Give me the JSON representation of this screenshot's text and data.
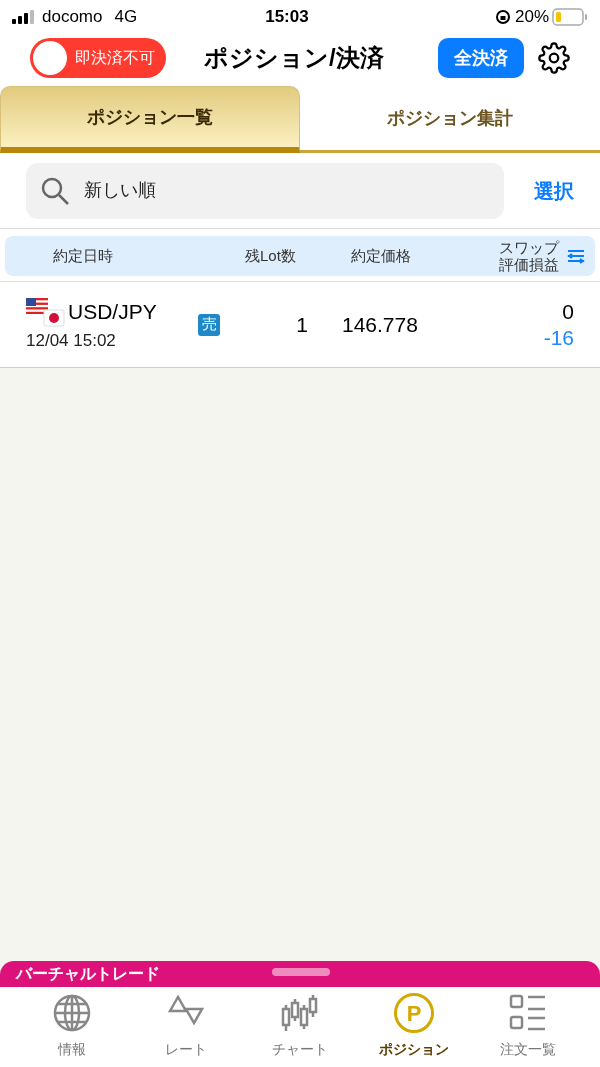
{
  "status_bar": {
    "carrier": "docomo",
    "network": "4G",
    "time": "15:03",
    "battery": "20%"
  },
  "header": {
    "toggle": {
      "label": "即決済不可",
      "on": false
    },
    "title": "ポジション/決済",
    "close_all": "全決済"
  },
  "tabs": [
    {
      "label": "ポジション一覧",
      "selected": true
    },
    {
      "label": "ポジション集計",
      "selected": false
    }
  ],
  "search": {
    "value": "新しい順",
    "select": "選択"
  },
  "table": {
    "columns": [
      "約定日時",
      "残Lot数",
      "約定価格",
      "スワップ",
      "評価損益"
    ],
    "rows": [
      {
        "pair": "USD/JPY",
        "datetime": "12/04 15:02",
        "side": "売",
        "lots": "1",
        "price": "146.778",
        "swap": "0",
        "pnl": "-16"
      }
    ]
  },
  "banner": "バーチャルトレード",
  "nav": [
    {
      "label": "情報",
      "kind": "globe",
      "selected": false
    },
    {
      "label": "レート",
      "kind": "updown",
      "selected": false
    },
    {
      "label": "チャート",
      "kind": "candles",
      "selected": false
    },
    {
      "label": "ポジション",
      "kind": "coin",
      "icon_text": "P",
      "selected": true
    },
    {
      "label": "注文一覧",
      "kind": "list",
      "selected": false
    }
  ]
}
